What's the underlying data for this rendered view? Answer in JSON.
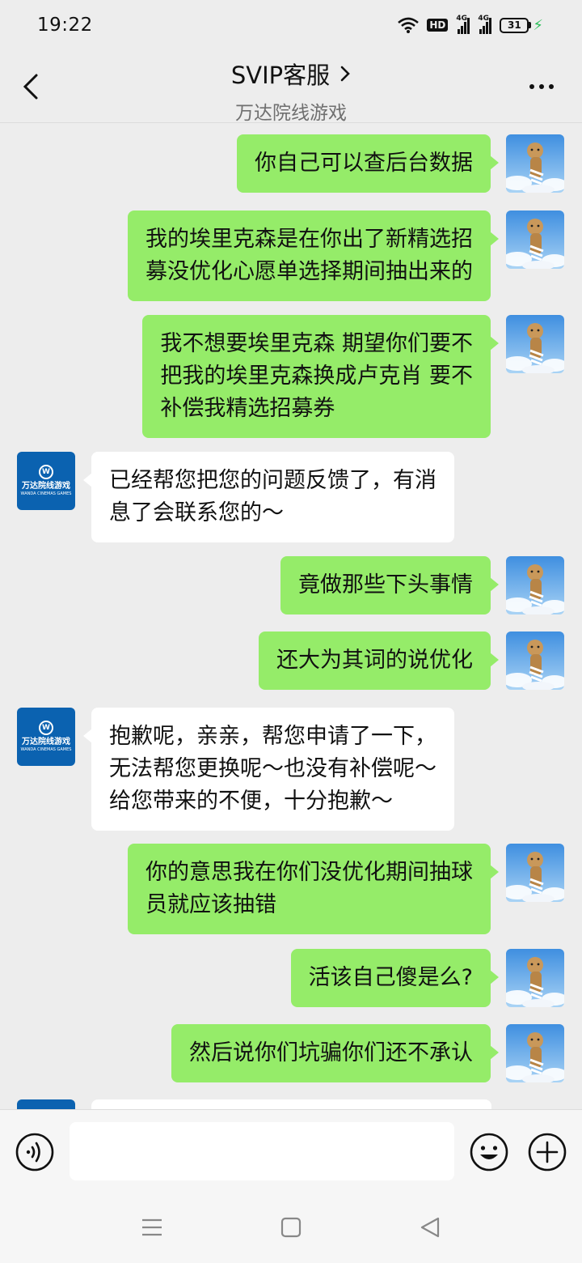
{
  "status_bar": {
    "time": "19:22",
    "hd_label": "HD",
    "net1": "4G",
    "net2": "4G",
    "battery": "31"
  },
  "header": {
    "title": "SVIP客服",
    "subtitle": "万达院线游戏"
  },
  "colors": {
    "bubble_me": "#95ec69",
    "bubble_them": "#ffffff",
    "background": "#ededed",
    "brand_blue": "#0b62b0"
  },
  "messages": [
    {
      "from": "me",
      "text": "你自己可以查后台数据"
    },
    {
      "from": "me",
      "text": "我的埃里克森是在你出了新精选招\n募没优化心愿单选择期间抽出来的"
    },
    {
      "from": "me",
      "text": "我不想要埃里克森  期望你们要不\n把我的埃里克森换成卢克肖  要不\n补偿我精选招募券"
    },
    {
      "from": "them",
      "text": "已经帮您把您的问题反馈了，有消\n息了会联系您的～"
    },
    {
      "from": "me",
      "text": "竟做那些下头事情"
    },
    {
      "from": "me",
      "text": "还大为其词的说优化"
    },
    {
      "from": "them",
      "text": "抱歉呢，亲亲，帮您申请了一下，\n无法帮您更换呢～也没有补偿呢～\n给您带来的不便，十分抱歉～"
    },
    {
      "from": "me",
      "text": "你的意思我在你们没优化期间抽球\n员就应该抽错"
    },
    {
      "from": "me",
      "text": "活该自己傻是么?"
    },
    {
      "from": "me",
      "text": "然后说你们坑骗你们还不承认"
    },
    {
      "from": "them",
      "text": ""
    }
  ],
  "agent_logo": {
    "cn": "万达院线游戏",
    "en": "WANDA CINEMAS GAMES"
  },
  "input": {
    "value": ""
  }
}
